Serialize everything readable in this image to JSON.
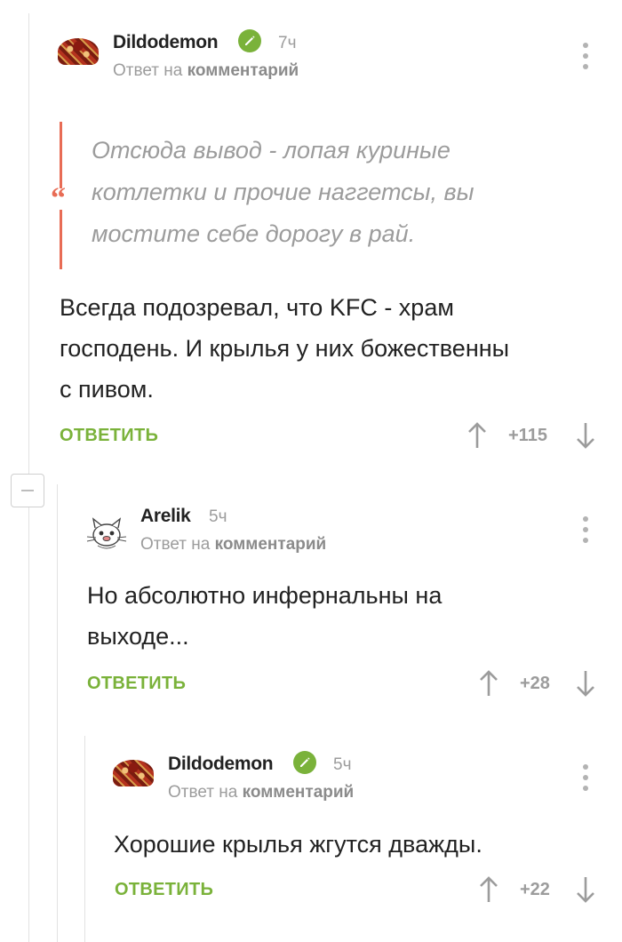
{
  "comments": [
    {
      "author": "Dildodemon",
      "time": "7ч",
      "reply_prefix": "Ответ на",
      "reply_target": "комментарий",
      "quote": [
        "Отсюда вывод - лопая куриные",
        "котлетки и прочие наггетсы, вы",
        "мостите себе дорогу в рай."
      ],
      "text": [
        "Всегда подозревал, что KFC - храм",
        "господень. И крылья у них божественны",
        "с пивом."
      ],
      "reply_label": "ОТВЕТИТЬ",
      "score": "+115"
    },
    {
      "author": "Arelik",
      "time": "5ч",
      "reply_prefix": "Ответ на",
      "reply_target": "комментарий",
      "text": [
        "Но абсолютно инфернальны на",
        "выходе..."
      ],
      "reply_label": "ОТВЕТИТЬ",
      "score": "+28"
    },
    {
      "author": "Dildodemon",
      "time": "5ч",
      "reply_prefix": "Ответ на",
      "reply_target": "комментарий",
      "text": [
        "Хорошие крылья жгутся дважды."
      ],
      "reply_label": "ОТВЕТИТЬ",
      "score": "+22"
    }
  ],
  "colors": {
    "accent_green": "#7ab23a",
    "quote_red": "#e86c55",
    "muted_gray": "#9c9c9c"
  },
  "icons": [
    "pencil-icon",
    "kebab-menu-icon",
    "arrow-up-icon",
    "arrow-down-icon",
    "quote-icon",
    "minus-icon"
  ]
}
